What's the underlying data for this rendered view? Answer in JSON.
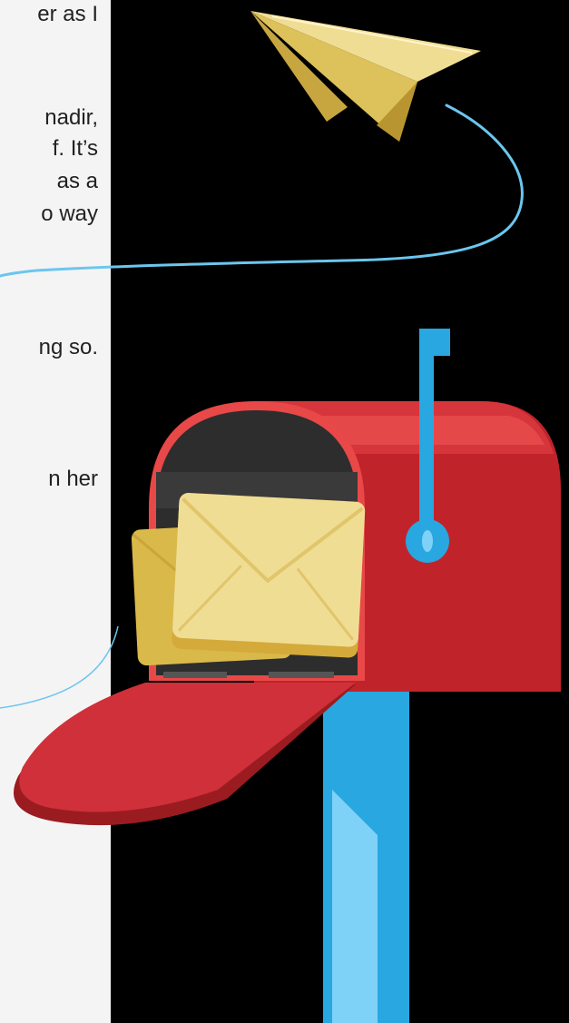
{
  "article": {
    "fragments": [
      "er as I",
      "nadir,",
      "f. It’s",
      "as a",
      "o way",
      "ng so.",
      "n her"
    ]
  },
  "illustration": {
    "icons": [
      "paper-plane-icon",
      "mailbox-icon",
      "envelope-icon",
      "mailbox-flag-icon"
    ],
    "colors": {
      "background": "#000000",
      "text_panel": "#f4f4f4",
      "mailbox_red": "#c0242a",
      "mailbox_highlight": "#e95050",
      "post_blue": "#29a7e0",
      "post_light": "#7fd2f7",
      "envelope": "#f0dd94",
      "envelope_dark": "#d9b94a",
      "trail": "#6cc6ef"
    }
  }
}
